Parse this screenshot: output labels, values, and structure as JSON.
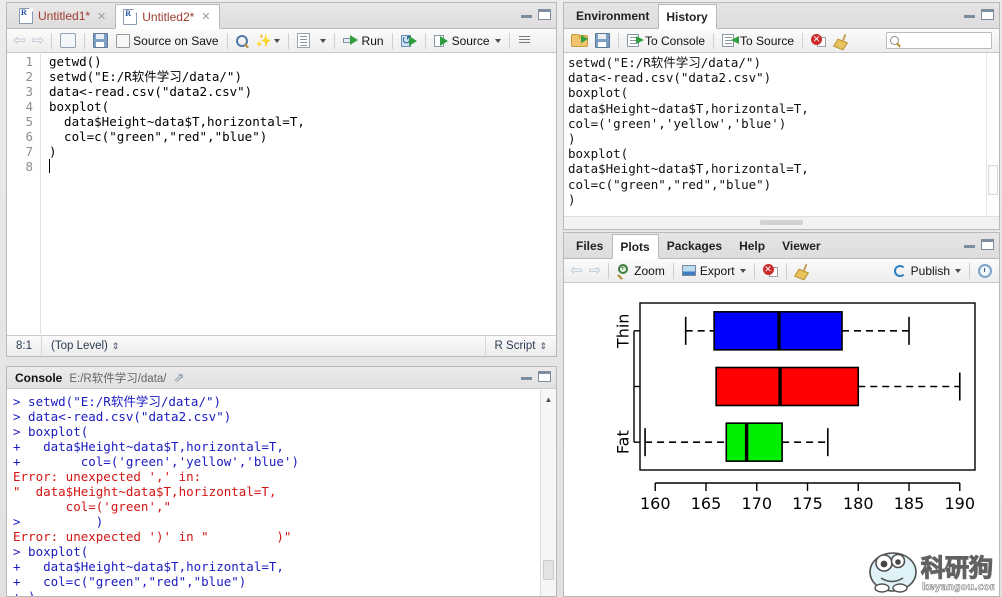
{
  "source_editor": {
    "tabs": [
      {
        "label": "Untitled1*",
        "icon": "r-document-icon",
        "active": false
      },
      {
        "label": "Untitled2*",
        "icon": "r-document-icon",
        "active": true
      }
    ],
    "toolbar": {
      "back_icon": "back-arrow-icon",
      "forward_icon": "forward-arrow-icon",
      "popout_icon": "show-in-new-window-icon",
      "save_icon": "save-icon",
      "source_on_save_label": "Source on Save",
      "find_icon": "find-replace-icon",
      "magic_icon": "code-tools-icon",
      "compile_icon": "compile-report-icon",
      "run_label": "Run",
      "rerun_icon": "rerun-previous-icon",
      "source_label": "Source",
      "outline_icon": "document-outline-icon"
    },
    "code_lines": [
      {
        "n": "1",
        "text": "getwd()"
      },
      {
        "n": "2",
        "text": "setwd(\"E:/R软件学习/data/\")"
      },
      {
        "n": "3",
        "text": "data<-read.csv(\"data2.csv\")"
      },
      {
        "n": "4",
        "text": "boxplot("
      },
      {
        "n": "5",
        "text": "  data$Height~data$T,horizontal=T,"
      },
      {
        "n": "6",
        "text": "  col=c(\"green\",\"red\",\"blue\")"
      },
      {
        "n": "7",
        "text": ")"
      },
      {
        "n": "8",
        "text": ""
      }
    ],
    "status": {
      "cursor_position": "8:1",
      "scope": "(Top Level)",
      "file_type": "R Script"
    }
  },
  "console": {
    "title": "Console",
    "path": "E:/R软件学习/data/",
    "popout_icon": "console-popout-icon",
    "lines": [
      {
        "type": "prompt",
        "text": "> setwd(\"E:/R软件学习/data/\")"
      },
      {
        "type": "prompt",
        "text": "> data<-read.csv(\"data2.csv\")"
      },
      {
        "type": "prompt",
        "text": "> boxplot("
      },
      {
        "type": "cont",
        "text": "+   data$Height~data$T,horizontal=T,"
      },
      {
        "type": "cont",
        "text": "+        col=('green','yellow','blue')"
      },
      {
        "type": "error",
        "text": "Error: unexpected ',' in:"
      },
      {
        "type": "error",
        "text": "\"  data$Height~data$T,horizontal=T,"
      },
      {
        "type": "error",
        "text": "       col=('green',\""
      },
      {
        "type": "prompt",
        "text": ">          )"
      },
      {
        "type": "error",
        "text": "Error: unexpected ')' in \"         )\""
      },
      {
        "type": "prompt",
        "text": "> boxplot("
      },
      {
        "type": "cont",
        "text": "+   data$Height~data$T,horizontal=T,"
      },
      {
        "type": "cont",
        "text": "+   col=c(\"green\",\"red\",\"blue\")"
      },
      {
        "type": "cont",
        "text": "+ )"
      }
    ]
  },
  "env_history": {
    "tabs": [
      {
        "label": "Environment",
        "active": false
      },
      {
        "label": "History",
        "active": true
      }
    ],
    "toolbar": {
      "open_icon": "open-file-icon",
      "save_icon": "save-icon",
      "to_console_label": "To Console",
      "to_source_label": "To Source",
      "remove_icon": "remove-entry-icon",
      "clear_icon": "clear-all-icon",
      "search_placeholder": ""
    },
    "entries": [
      "setwd(\"E:/R软件学习/data/\")",
      "data<-read.csv(\"data2.csv\")",
      "boxplot(",
      "data$Height~data$T,horizontal=T,",
      "col=('green','yellow','blue')",
      ")",
      "boxplot(",
      "data$Height~data$T,horizontal=T,",
      "col=c(\"green\",\"red\",\"blue\")",
      ")"
    ]
  },
  "plots_panel": {
    "tabs": [
      {
        "label": "Files",
        "active": false
      },
      {
        "label": "Plots",
        "active": true
      },
      {
        "label": "Packages",
        "active": false
      },
      {
        "label": "Help",
        "active": false
      },
      {
        "label": "Viewer",
        "active": false
      }
    ],
    "toolbar": {
      "prev_icon": "previous-plot-icon",
      "next_icon": "next-plot-icon",
      "zoom_label": "Zoom",
      "export_label": "Export",
      "remove_icon": "remove-plot-icon",
      "clear_icon": "clear-all-plots-icon",
      "publish_label": "Publish",
      "refresh_icon": "refresh-icon"
    }
  },
  "watermark": {
    "chinese": "科研狗",
    "domain": "keyangou.com"
  },
  "colors": {
    "box_green": "#00ee00",
    "box_red": "#ff0000",
    "box_blue": "#0000ff",
    "console_code": "#1b1bc4",
    "console_error": "#d41414",
    "editor_string": "#119911",
    "tab_doc_text": "#9d3b2f"
  },
  "chart_data": {
    "type": "box",
    "orientation": "horizontal",
    "title": "",
    "xlabel": "",
    "ylabel": "",
    "xlim": [
      158.5,
      191.5
    ],
    "xticks": [
      160,
      165,
      170,
      175,
      180,
      185,
      190
    ],
    "ytick_labels": [
      "Fat",
      "",
      "Thin"
    ],
    "grid": false,
    "legend": false,
    "boxes": [
      {
        "name": "Fat",
        "color": "#00ee00",
        "whisker_low": 159.0,
        "q1": 167.0,
        "median": 169.0,
        "q3": 172.5,
        "whisker_high": 177.0
      },
      {
        "name": "",
        "color": "#ff0000",
        "whisker_low": 166.0,
        "q1": 166.0,
        "median": 172.3,
        "q3": 180.0,
        "whisker_high": 190.0
      },
      {
        "name": "Thin",
        "color": "#0000ff",
        "whisker_low": 163.0,
        "q1": 165.8,
        "median": 172.2,
        "q3": 178.4,
        "whisker_high": 185.0
      }
    ]
  }
}
